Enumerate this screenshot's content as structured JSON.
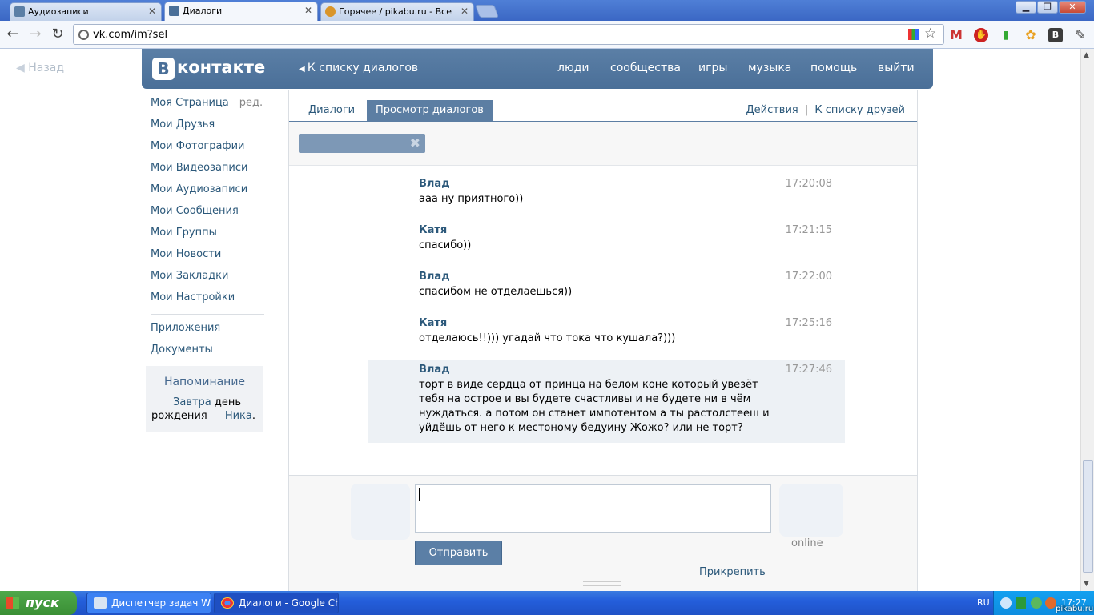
{
  "browser": {
    "tabs": [
      {
        "title": "Аудиозаписи"
      },
      {
        "title": "Диалоги"
      },
      {
        "title": "Горячее / pikabu.ru - Все"
      }
    ],
    "url": "vk.com/im?sel"
  },
  "page": {
    "back_label": "Назад",
    "logo_text": "контакте",
    "logo_letter": "B",
    "back_to_list": "К списку диалогов",
    "top_nav": [
      "люди",
      "сообщества",
      "игры",
      "музыка",
      "помощь",
      "выйти"
    ],
    "left_nav": [
      "Моя Страница",
      "Мои Друзья",
      "Мои Фотографии",
      "Мои Видеозаписи",
      "Мои Аудиозаписи",
      "Мои Сообщения",
      "Мои Группы",
      "Мои Новости",
      "Мои Закладки",
      "Мои Настройки"
    ],
    "edit_label": "ред.",
    "left_nav_extra": [
      "Приложения",
      "Документы"
    ],
    "reminder": {
      "title": "Напоминание",
      "link1": "Завтра",
      "text1": "день рождения",
      "link2": "Ника",
      "dot": "."
    },
    "tabs": [
      "Диалоги",
      "Просмотр диалогов"
    ],
    "actions": "Действия",
    "sep": "|",
    "friends_list": "К списку друзей",
    "messages": [
      {
        "author": "Влад",
        "time": "17:20:08",
        "text": "ааа ну приятного))"
      },
      {
        "author": "Катя",
        "time": "17:21:15",
        "text": "спасибо))"
      },
      {
        "author": "Влад",
        "time": "17:22:00",
        "text": "спасибом не отделаешься))"
      },
      {
        "author": "Катя",
        "time": "17:25:16",
        "text": "отделаюсь!!))) угадай что тока что кушала?)))"
      },
      {
        "author": "Влад",
        "time": "17:27:46",
        "text": "торт в виде сердца от принца на белом коне который увезёт тебя на острое и вы будете счастливы и не будете ни в чём нуждаться. а потом он станет импотентом а ты растолстееш и уйдёшь от него к местоному бедуину Жожо? или не торт?"
      }
    ],
    "send_label": "Отправить",
    "online_label": "online",
    "attach_label": "Прикрепить"
  },
  "taskbar": {
    "start_label": "пуск",
    "items": [
      "Диспетчер задач Wi...",
      "Диалоги - Google Ch..."
    ],
    "lang": "RU",
    "clock": "17:27",
    "watermark": "pikabu.ru"
  }
}
